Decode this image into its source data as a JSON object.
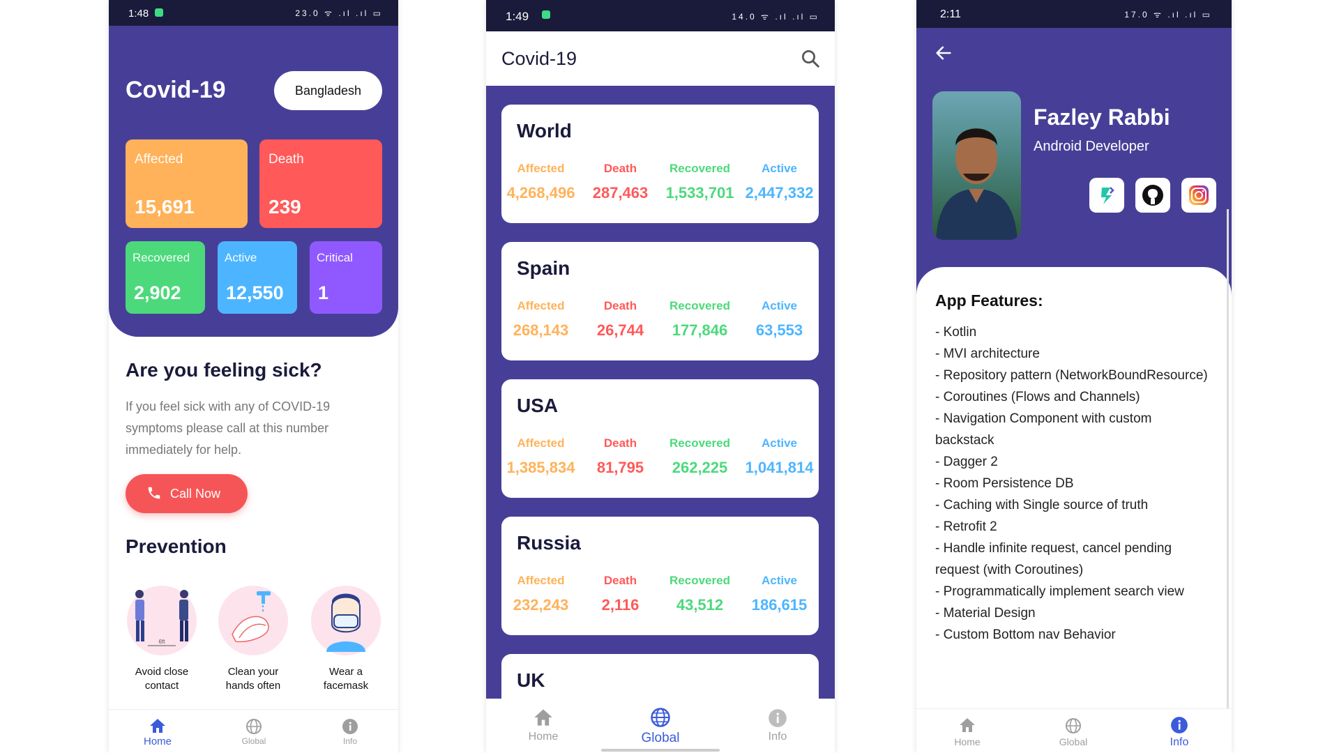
{
  "phone1": {
    "status": {
      "time": "1:48",
      "icons": "23.0 ᯤ .ıl .ıl ▭"
    },
    "title": "Covid-19",
    "country": "Bangladesh",
    "stats": {
      "affected": {
        "label": "Affected",
        "value": "15,691",
        "color": "#ffb259"
      },
      "death": {
        "label": "Death",
        "value": "239",
        "color": "#ff5959"
      },
      "recovered": {
        "label": "Recovered",
        "value": "2,902",
        "color": "#4cd97b"
      },
      "active": {
        "label": "Active",
        "value": "12,550",
        "color": "#4db5ff"
      },
      "critical": {
        "label": "Critical",
        "value": "1",
        "color": "#9059ff"
      }
    },
    "sick_heading": "Are you feeling sick?",
    "sick_text": "If you feel sick with any of COVID-19 symptoms please call at this number immediately for help.",
    "call_label": "Call Now",
    "prevention_heading": "Prevention",
    "prevention": [
      {
        "caption": "Avoid close contact",
        "icon": "distance-icon"
      },
      {
        "caption": "Clean your hands often",
        "icon": "handwash-icon"
      },
      {
        "caption": "Wear a facemask",
        "icon": "facemask-icon"
      }
    ],
    "nav": [
      {
        "label": "Home",
        "active": true
      },
      {
        "label": "Global",
        "active": false
      },
      {
        "label": "Info",
        "active": false
      }
    ]
  },
  "phone2": {
    "status": {
      "time": "1:49",
      "icons": "14.0 ᯤ .ıl .ıl ▭"
    },
    "title": "Covid-19",
    "labels": {
      "affected": "Affected",
      "death": "Death",
      "recovered": "Recovered",
      "active": "Active"
    },
    "countries": [
      {
        "name": "World",
        "affected": "4,268,496",
        "death": "287,463",
        "recovered": "1,533,701",
        "active": "2,447,332"
      },
      {
        "name": "Spain",
        "affected": "268,143",
        "death": "26,744",
        "recovered": "177,846",
        "active": "63,553"
      },
      {
        "name": "USA",
        "affected": "1,385,834",
        "death": "81,795",
        "recovered": "262,225",
        "active": "1,041,814"
      },
      {
        "name": "Russia",
        "affected": "232,243",
        "death": "2,116",
        "recovered": "43,512",
        "active": "186,615"
      },
      {
        "name": "UK"
      }
    ],
    "nav": [
      {
        "label": "Home",
        "active": false
      },
      {
        "label": "Global",
        "active": true
      },
      {
        "label": "Info",
        "active": false
      }
    ]
  },
  "phone3": {
    "status": {
      "time": "2:11",
      "icons": "17.0 ᯤ .ıl .ıl ▭"
    },
    "name": "Fazley Rabbi",
    "role": "Android Developer",
    "social": [
      "blog-icon",
      "github-icon",
      "instagram-icon"
    ],
    "features_heading": "App Features:",
    "features": [
      "- Kotlin",
      "- MVI architecture",
      "- Repository pattern (NetworkBoundResource)",
      "- Coroutines (Flows and Channels)",
      "- Navigation Component with custom backstack",
      "- Dagger 2",
      "- Room Persistence DB",
      "- Caching with Single source of truth",
      "- Retrofit 2",
      "- Handle infinite request, cancel pending request (with Coroutines)",
      "- Programmatically implement search view",
      "- Material Design",
      "- Custom Bottom nav Behavior"
    ],
    "nav": [
      {
        "label": "Home",
        "active": false
      },
      {
        "label": "Global",
        "active": false
      },
      {
        "label": "Info",
        "active": true
      }
    ]
  },
  "colors": {
    "primary": "#473f97",
    "dark": "#1a1a3b",
    "accent": "#3b5bdb",
    "nav_inactive": "#9e9e9e"
  }
}
